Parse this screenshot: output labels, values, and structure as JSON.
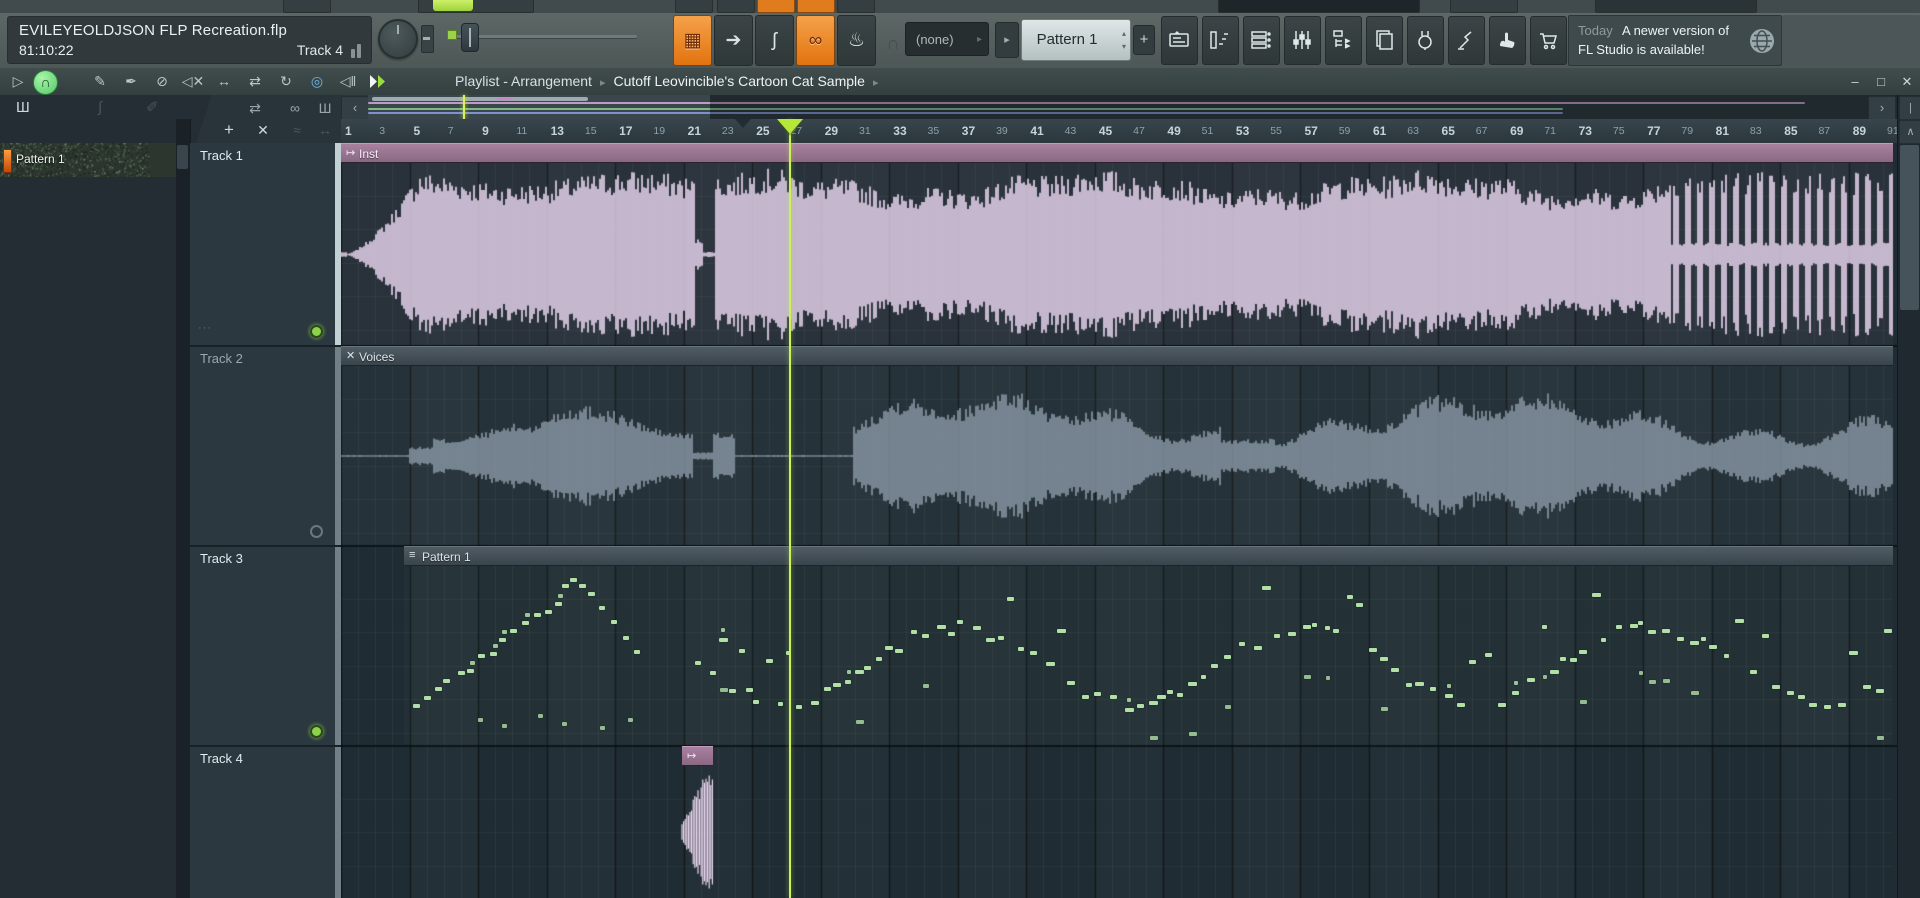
{
  "titlebar": {
    "project": "EVILEYEOLDJSON FLP Recreation.flp",
    "time": "81:10:22",
    "hint": "Track 4"
  },
  "toolbar": {
    "none_label": "(none)",
    "pattern_selector": "Pattern 1",
    "add_label": "+",
    "buttons": [
      {
        "name": "pattern-song-switch",
        "glyph": "▦",
        "orange": true
      },
      {
        "name": "follow-playback",
        "glyph": "➔",
        "orange": false
      },
      {
        "name": "glide",
        "glyph": "ʃ",
        "orange": false
      },
      {
        "name": "link-controllers",
        "glyph": "∞",
        "orange": true
      },
      {
        "name": "typing-to-piano",
        "glyph": "♨",
        "orange": false
      }
    ],
    "magnet_glyph": "∩",
    "none_caret": "▸",
    "pattern_play_caret": "▸",
    "spinner_up": "▴",
    "spinner_down": "▾"
  },
  "notification": {
    "when": "Today",
    "message_line1": "A newer version of",
    "message_line2": "FL Studio is available!"
  },
  "transport": {
    "play_glyph": "▷",
    "magnet_glyph": "∩",
    "tools": [
      {
        "name": "draw-tool-icon",
        "glyph": "✎"
      },
      {
        "name": "paint-tool-icon",
        "glyph": "✒"
      },
      {
        "name": "delete-tool-icon",
        "glyph": "⊘"
      },
      {
        "name": "mute-tool-icon",
        "glyph": "◁✕"
      },
      {
        "name": "slide-tool-icon",
        "glyph": "↔"
      },
      {
        "name": "slip-tool-icon",
        "glyph": "⇄"
      },
      {
        "name": "loop-tool-icon",
        "glyph": "↻"
      },
      {
        "name": "zoom-tool-icon",
        "glyph": "◎"
      },
      {
        "name": "playback-preview-icon",
        "glyph": "◁‖"
      }
    ],
    "breadcrumb_view": "Playlist - Arrangement",
    "breadcrumb_item": "Cutoff Leovincible's Cartoon Cat Sample",
    "crumb_sep": "▸"
  },
  "window_controls": {
    "minimize": "–",
    "maximize": "□",
    "close": "✕"
  },
  "panel_icons": {
    "picker": "Ш",
    "automation": "∫",
    "pencil": "✐"
  },
  "playlist_tools": {
    "detect": "⇄",
    "link": "∞",
    "piano": "Ш",
    "add": "+",
    "delete": "✕",
    "slide_a": "≈",
    "slide_b": "↔"
  },
  "overview": {
    "left_arrow": "‹",
    "right_arrow": "›",
    "end_button": "|"
  },
  "pattern_panel": {
    "items": [
      {
        "label": "Pattern 1"
      }
    ]
  },
  "ruler": {
    "start": 1,
    "end": 91,
    "step": 2,
    "emphasize_every": 4,
    "playhead_bar": 27
  },
  "tracks": [
    {
      "name": "Track 1",
      "clip_label": "Inst",
      "clip_icon": "↦",
      "status": "armed"
    },
    {
      "name": "Track 2",
      "clip_label": "Voices",
      "clip_icon": "✕",
      "status": "idle"
    },
    {
      "name": "Track 3",
      "clip_label": "Pattern 1",
      "clip_icon": "≡",
      "status": "armed"
    },
    {
      "name": "Track 4",
      "clip_label": "",
      "clip_icon": "↦",
      "status": "none"
    }
  ],
  "scrollbar": {
    "up": "∧"
  },
  "colors": {
    "accent_orange": "#e8821e",
    "playhead_green": "#b6e83c",
    "clip_pink_header": "#96738f",
    "waveform_pink": "#ecd9f2",
    "waveform_gray": "#8a99a6",
    "midi_green": "#b2dfa8",
    "overview_pink": "#c09ac0",
    "overview_green": "#7fb789",
    "overview_blue": "#8090cf"
  }
}
